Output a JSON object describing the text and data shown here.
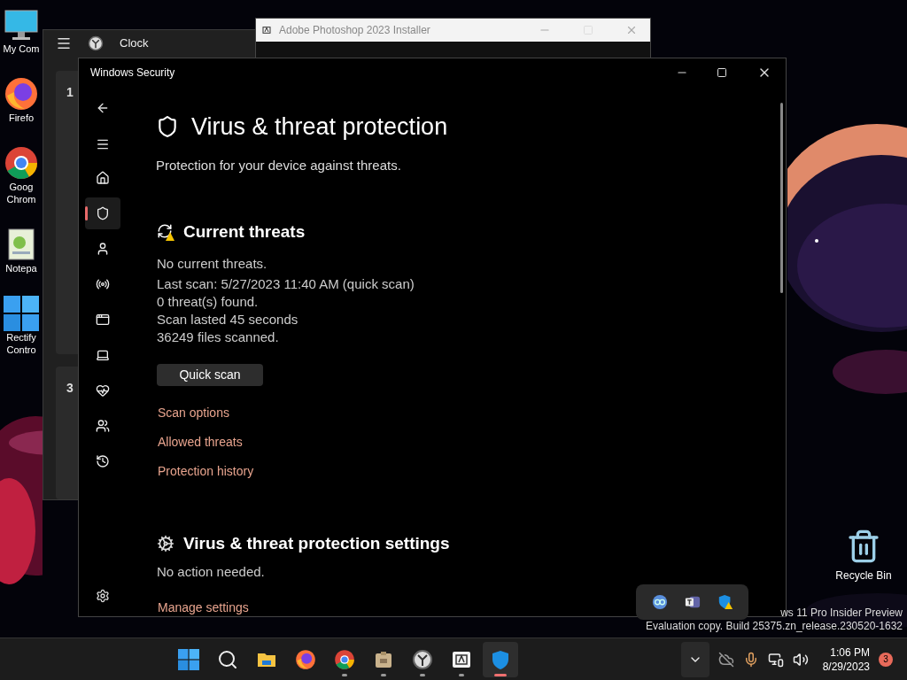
{
  "desktop_icons": [
    {
      "kind": "computer",
      "lines": [
        "My Com"
      ]
    },
    {
      "kind": "firefox",
      "lines": [
        "Firefo"
      ]
    },
    {
      "kind": "chrome",
      "lines": [
        "Goog",
        "Chrom"
      ]
    },
    {
      "kind": "notepad",
      "lines": [
        "Notepa"
      ]
    },
    {
      "kind": "rectify",
      "lines": [
        "Rectify",
        "Contro"
      ]
    }
  ],
  "recycle_bin": {
    "label": "Recycle Bin"
  },
  "clock_window": {
    "title": "Clock",
    "cards": [
      "1",
      "3"
    ]
  },
  "installer_window": {
    "title": "Adobe Photoshop 2023 Installer"
  },
  "security_window": {
    "title": "Windows Security",
    "nav": [
      {
        "kind": "home",
        "selected": false
      },
      {
        "kind": "shield",
        "selected": true
      },
      {
        "kind": "account",
        "selected": false
      },
      {
        "kind": "network",
        "selected": false
      },
      {
        "kind": "app",
        "selected": false
      },
      {
        "kind": "device",
        "selected": false
      },
      {
        "kind": "health",
        "selected": false
      },
      {
        "kind": "family",
        "selected": false
      },
      {
        "kind": "history",
        "selected": false
      }
    ],
    "heading": "Virus & threat protection",
    "subtitle": "Protection for your device against threats.",
    "current_threats": {
      "title": "Current threats",
      "status": "No current threats.",
      "details": [
        "Last scan: 5/27/2023 11:40 AM (quick scan)",
        "0 threat(s) found.",
        "Scan lasted 45 seconds",
        "36249 files scanned."
      ],
      "button": "Quick scan",
      "links": [
        "Scan options",
        "Allowed threats",
        "Protection history"
      ]
    },
    "settings_section": {
      "title": "Virus & threat protection settings",
      "status": "No action needed.",
      "link": "Manage settings"
    }
  },
  "tray_popup": {
    "icons": [
      {
        "kind": "meet"
      },
      {
        "kind": "teams"
      },
      {
        "kind": "security"
      }
    ]
  },
  "watermark": [
    "ws 11 Pro Insider Preview",
    "Evaluation copy. Build 25375.zn_release.230520-1632"
  ],
  "taskbar": {
    "apps": [
      {
        "kind": "start",
        "running": false,
        "selected": false
      },
      {
        "kind": "search",
        "running": false,
        "selected": false
      },
      {
        "kind": "explorer",
        "running": false,
        "selected": false
      },
      {
        "kind": "firefox",
        "running": false,
        "selected": false
      },
      {
        "kind": "chrome",
        "running": true,
        "selected": false
      },
      {
        "kind": "package",
        "running": true,
        "selected": false
      },
      {
        "kind": "clock",
        "running": true,
        "selected": false
      },
      {
        "kind": "adobe",
        "running": true,
        "selected": false
      },
      {
        "kind": "security",
        "running": true,
        "selected": true
      }
    ],
    "time": "1:06 PM",
    "date": "8/29/2023",
    "notification_count": "3"
  }
}
